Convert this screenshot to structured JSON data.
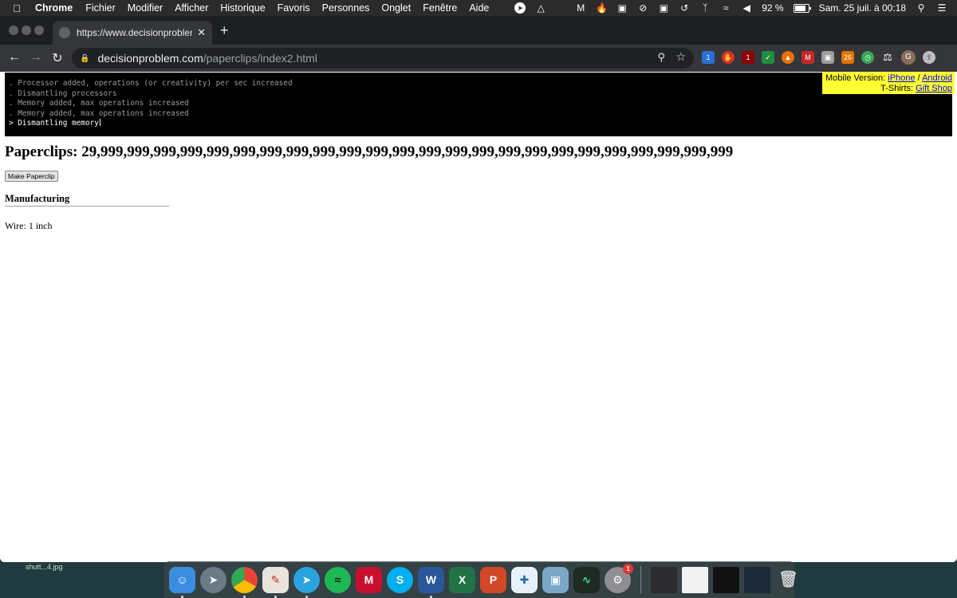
{
  "menubar": {
    "app": "Chrome",
    "items": [
      "Fichier",
      "Modifier",
      "Afficher",
      "Historique",
      "Favoris",
      "Personnes",
      "Onglet",
      "Fenêtre",
      "Aide"
    ],
    "battery": "92 %",
    "datetime": "Sam. 25 juil. à  00:18"
  },
  "browser": {
    "tab_title": "https://www.decisionproblem.c",
    "url_host": "decisionproblem.com",
    "url_path": "/paperclips/index2.html",
    "extension_badges": {
      "first": "1",
      "second": "1",
      "calendar": "26"
    },
    "avatar_letter": "G"
  },
  "page": {
    "console_lines": [
      ". Processor added, operations (or creativity) per sec increased",
      ". Dismantling processors",
      ". Memory added, max operations increased",
      ". Memory added, max operations increased"
    ],
    "console_current": "> Dismantling memory",
    "promo": {
      "mobile_label": "Mobile Version: ",
      "iphone": "iPhone",
      "sep": " / ",
      "android": "Android",
      "tshirt_label": "T-Shirts: ",
      "gift_shop": "Gift Shop"
    },
    "paperclips_label": "Paperclips: ",
    "paperclips_count": "29,999,999,999,999,999,999,999,999,999,999,999,999,999,999,999,999,999,999,999,999,999,999,999,999",
    "make_button": "Make Paperclip",
    "manufacturing_heading": "Manufacturing",
    "wire_label": "Wire: ",
    "wire_value": "1 inch"
  },
  "desktop": {
    "file_label": "shutt...4.jpg",
    "dock_badge": "1"
  }
}
